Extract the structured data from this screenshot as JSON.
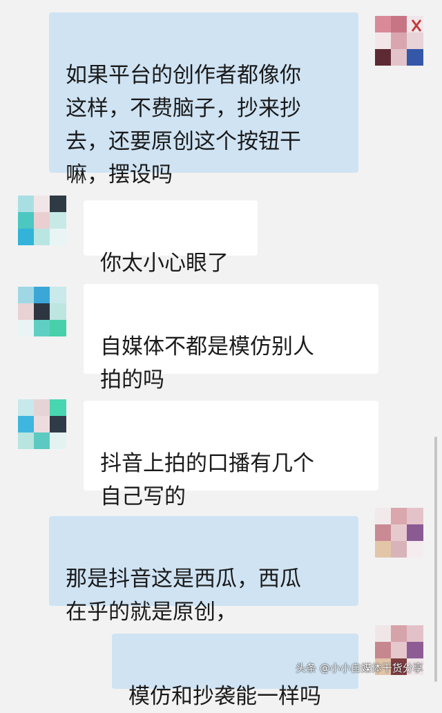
{
  "chat": {
    "messages": [
      {
        "side": "sent",
        "text": "如果平台的创作者都像你\n这样，不费脑子，抄来抄\n去，还要原创这个按钮干\n嘛，摆设吗"
      },
      {
        "side": "received",
        "text": "你太小心眼了"
      },
      {
        "side": "received",
        "text": "自媒体不都是模仿别人\n拍的吗"
      },
      {
        "side": "received",
        "text": "抖音上拍的口播有几个\n自己写的"
      },
      {
        "side": "sent",
        "text": "那是抖音这是西瓜，西瓜\n在乎的就是原创，"
      },
      {
        "side": "sent",
        "text": "模仿和抄袭能一样吗"
      }
    ]
  },
  "watermark": {
    "text": "头条 @小小自媒体干货分享"
  },
  "colors": {
    "background": "#f2f2f2",
    "sent_bubble": "#cfe3f3",
    "received_bubble": "#ffffff",
    "text": "#1a1a1a"
  }
}
